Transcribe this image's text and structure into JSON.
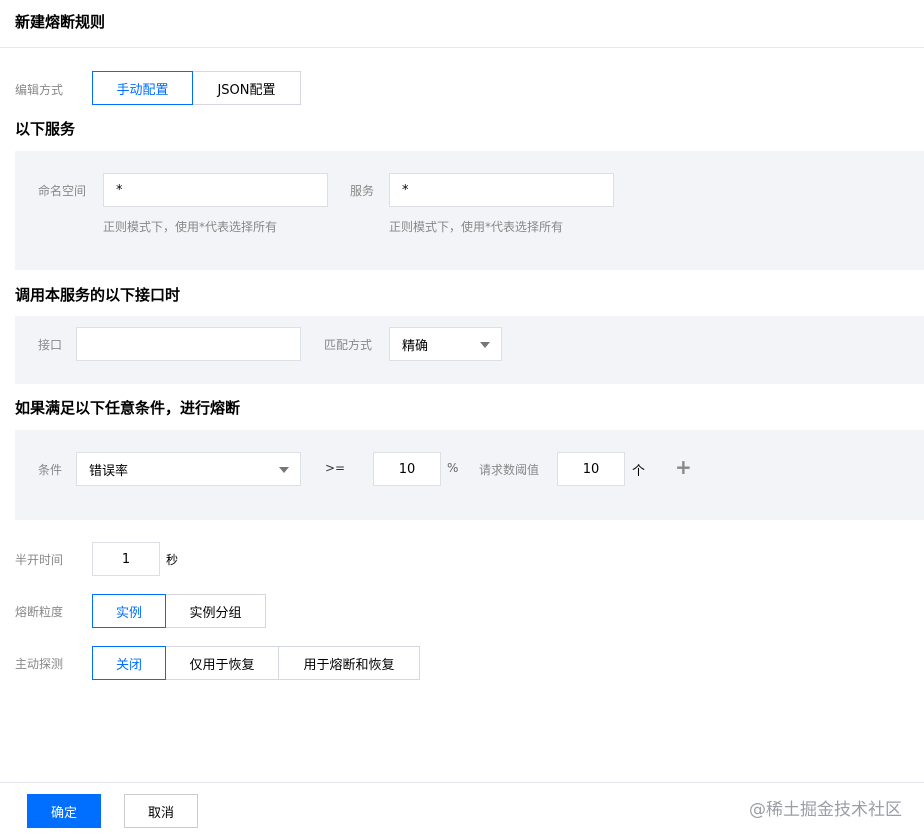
{
  "page_title": "新建熔断规则",
  "edit_mode": {
    "label": "编辑方式",
    "options": [
      "手动配置",
      "JSON配置"
    ],
    "selected": 0
  },
  "section_service": {
    "title": "以下服务",
    "namespace": {
      "label": "命名空间",
      "value": "*",
      "hint": "正则模式下，使用*代表选择所有"
    },
    "service": {
      "label": "服务",
      "value": "*",
      "hint": "正则模式下，使用*代表选择所有"
    }
  },
  "section_interface": {
    "title": "调用本服务的以下接口时",
    "interface": {
      "label": "接口",
      "value": ""
    },
    "match": {
      "label": "匹配方式",
      "value": "精确"
    }
  },
  "section_condition": {
    "title": "如果满足以下任意条件，进行熔断",
    "condition_label": "条件",
    "metric": "错误率",
    "operator": ">=",
    "threshold": "10",
    "threshold_unit": "%",
    "min_requests_label": "请求数阈值",
    "min_requests": "10",
    "min_requests_unit": "个",
    "add_symbol": "+"
  },
  "half_open": {
    "label": "半开时间",
    "value": "1",
    "unit": "秒"
  },
  "granularity": {
    "label": "熔断粒度",
    "options": [
      "实例",
      "实例分组"
    ],
    "selected": 0
  },
  "active_probe": {
    "label": "主动探测",
    "options": [
      "关闭",
      "仅用于恢复",
      "用于熔断和恢复"
    ],
    "selected": 0
  },
  "footer": {
    "confirm": "确定",
    "cancel": "取消",
    "watermark": "@稀土掘金技术社区"
  },
  "colors": {
    "accent": "#006eff",
    "panel": "#f3f4f7",
    "border": "#dcdfe6",
    "label": "#888888"
  }
}
